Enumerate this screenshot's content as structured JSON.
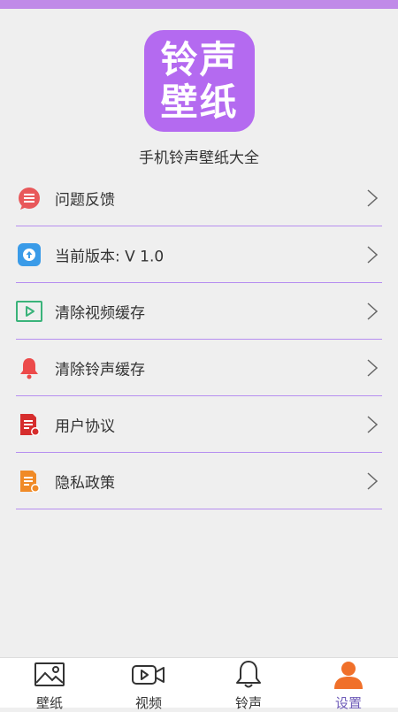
{
  "logo": {
    "line1": "铃声",
    "line2": "壁纸"
  },
  "app_name": "手机铃声壁纸大全",
  "menu": {
    "feedback": "问题反馈",
    "version": "当前版本:   V 1.0",
    "clear_video_cache": "清除视频缓存",
    "clear_ringtone_cache": "清除铃声缓存",
    "user_agreement": "用户协议",
    "privacy_policy": "隐私政策"
  },
  "tabs": {
    "wallpaper": "壁纸",
    "video": "视频",
    "ringtone": "铃声",
    "settings": "设置"
  },
  "colors": {
    "accent": "#b46af0",
    "divider": "#b68ef0",
    "active_tab": "#6e5bb8",
    "settings_icon": "#f0702a"
  }
}
